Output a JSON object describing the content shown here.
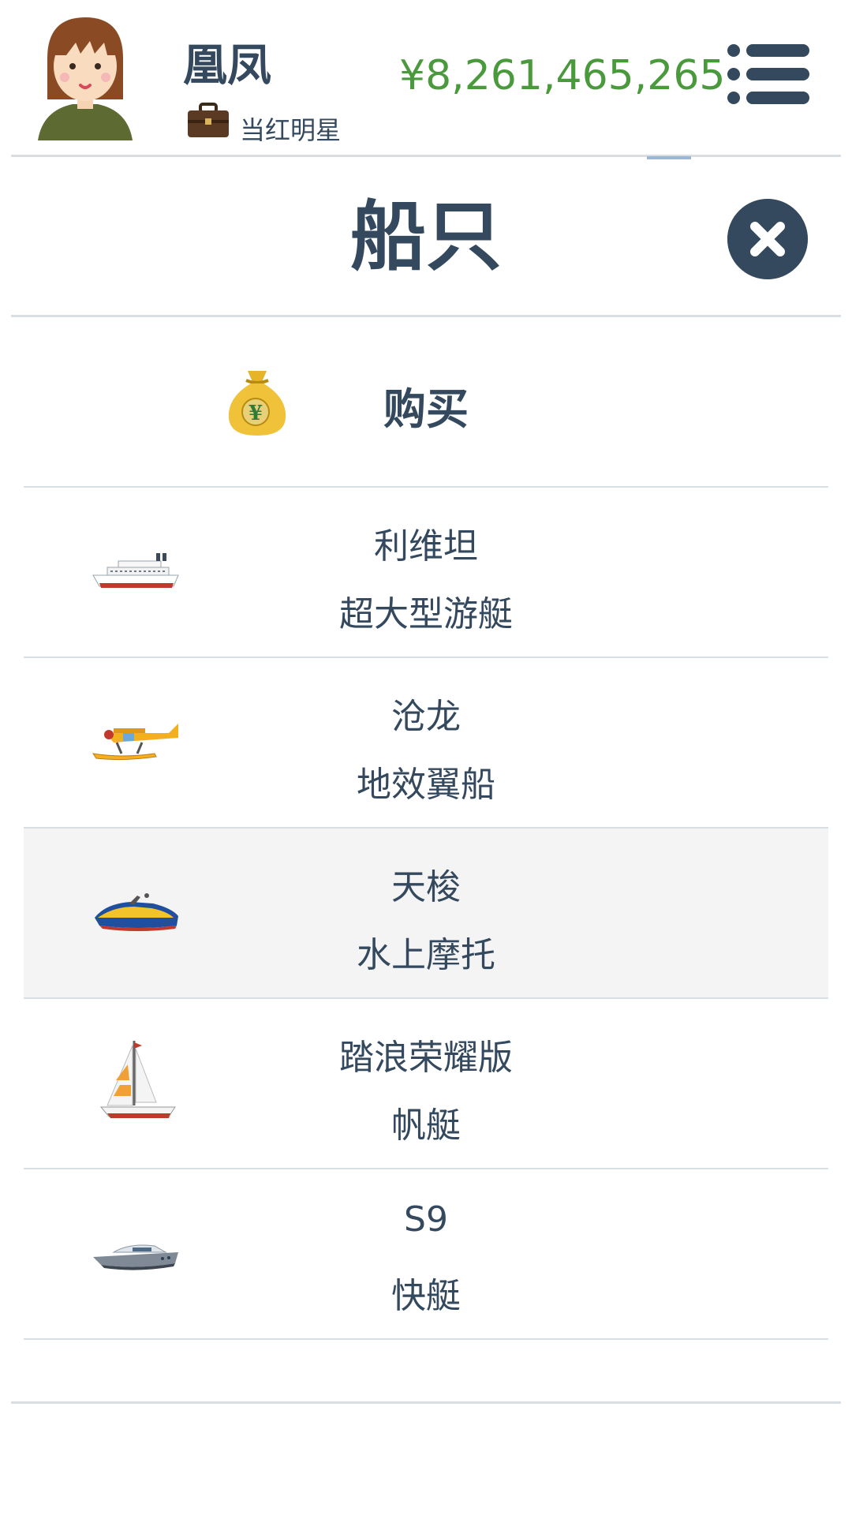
{
  "player": {
    "name": "凰凤",
    "job_title": "当红明星",
    "money": "¥8,261,465,265"
  },
  "modal": {
    "title": "船只"
  },
  "buy": {
    "label": "购买"
  },
  "boats": [
    {
      "name": "利维坦",
      "type": "超大型游艇",
      "icon": "cruise-ship-icon"
    },
    {
      "name": "沧龙",
      "type": "地效翼船",
      "icon": "seaplane-icon"
    },
    {
      "name": "天梭",
      "type": "水上摩托",
      "icon": "jet-ski-icon",
      "highlighted": true
    },
    {
      "name": "踏浪荣耀版",
      "type": "帆艇",
      "icon": "sailboat-icon"
    },
    {
      "name": "S9",
      "type": "快艇",
      "icon": "speedboat-icon"
    },
    {
      "name": "",
      "type": "",
      "icon": ""
    }
  ],
  "colors": {
    "text": "#34495e",
    "money": "#4a9a3d",
    "divider": "#d9dee3",
    "highlight_row": "#f4f4f4"
  }
}
